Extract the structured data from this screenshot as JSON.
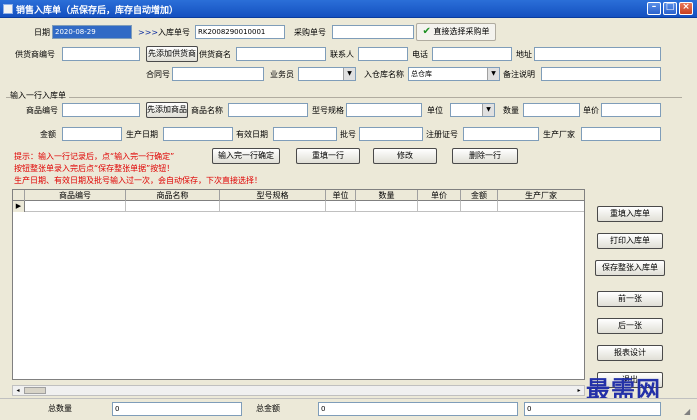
{
  "window": {
    "title": "销售入库单（点保存后，库存自动增加）",
    "controls": [
      "minimize-icon",
      "maximize-icon",
      "close-icon"
    ]
  },
  "header": {
    "date_label": "日期",
    "date_value": "2020-08-29",
    "next_glyph": ">>>",
    "order_no_label": "入库单号",
    "order_no_value": "RK2008290010001",
    "purchase_no_label": "采购单号",
    "direct_select_btn": "直接选择采购单",
    "supplier_code_label": "供货商编号",
    "add_supplier_btn": "先添加供货商",
    "supplier_name_label": "供货商名",
    "contact_label": "联系人",
    "phone_label": "电话",
    "address_label": "地址",
    "contract_label": "合同号",
    "salesman_label": "业务员",
    "warehouse_label": "入仓库名称",
    "warehouse_value": "总仓库",
    "remark_label": "备注说明"
  },
  "entry": {
    "group_label": "输入一行入库单",
    "product_code_label": "商品编号",
    "add_product_btn": "先添加商品",
    "product_name_label": "商品名称",
    "model_label": "型号规格",
    "unit_label": "单位",
    "qty_label": "数量",
    "price_label": "单价",
    "amount_label": "金额",
    "mfg_date_label": "生产日期",
    "expiry_label": "有效日期",
    "batch_label": "批号",
    "reg_label": "注册证号",
    "maker_label": "生产厂家"
  },
  "hints": {
    "line1": "提示：输入一行记录后，点“输入完一行确定”",
    "line2": "按钮整张单录入完后点“保存整张单据”按钮！",
    "line3": "生产日期、有效日期及批号输入过一次，会自动保存，下次直接选择！"
  },
  "actions": {
    "confirm_row": "输入完一行确定",
    "refill_row": "重填一行",
    "modify": "修改",
    "delete_row": "删除一行"
  },
  "grid": {
    "columns": [
      "商品编号",
      "商品名称",
      "型号规格",
      "单位",
      "数量",
      "单价",
      "金额",
      "生产厂家"
    ],
    "row_marker": "▶"
  },
  "side_buttons": {
    "refill_order": "重填入库单",
    "print_order": "打印入库单",
    "save_order": "保存整张入库单",
    "prev": "前一张",
    "next": "后一张",
    "report_design": "报表设计",
    "exit": "退出"
  },
  "footer": {
    "total_qty_label": "总数量",
    "total_qty_value": "0",
    "total_amount_label": "总金额",
    "total_amount_value": "0",
    "extra_value": "0"
  },
  "watermark": "最需网"
}
